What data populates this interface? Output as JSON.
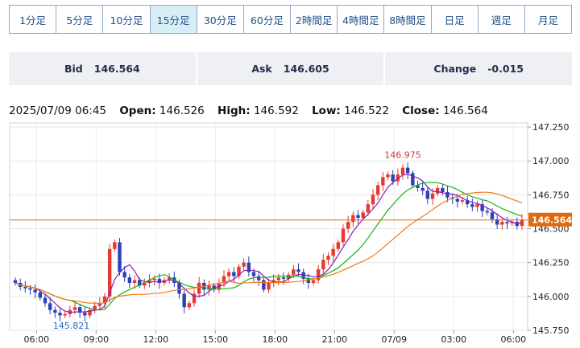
{
  "timeframes": [
    "1分足",
    "5分足",
    "10分足",
    "15分足",
    "30分足",
    "60分足",
    "2時間足",
    "4時間足",
    "8時間足",
    "日足",
    "週足",
    "月足"
  ],
  "active_timeframe": "15分足",
  "quote": {
    "bid_label": "Bid",
    "bid": "146.564",
    "ask_label": "Ask",
    "ask": "146.605",
    "change_label": "Change",
    "change": "-0.015"
  },
  "ohlc": {
    "timestamp": "2025/07/09 06:45",
    "open_label": "Open:",
    "open": "146.526",
    "high_label": "High:",
    "high": "146.592",
    "low_label": "Low:",
    "low": "146.522",
    "close_label": "Close:",
    "close": "146.564"
  },
  "chart_data": {
    "type": "candlestick",
    "y_ticks": [
      "147.250",
      "147.000",
      "146.750",
      "146.500",
      "146.250",
      "146.000",
      "145.750"
    ],
    "x_ticks": [
      "06:00",
      "09:00",
      "12:00",
      "15:00",
      "18:00",
      "21:00",
      "07/09",
      "03:00",
      "06:00"
    ],
    "ylim": [
      145.75,
      147.28
    ],
    "current_price_label": "146.564",
    "current_price": 146.564,
    "high_annotation": "146.975",
    "high_annotation_value": 146.975,
    "low_annotation": "145.821",
    "low_annotation_value": 145.821,
    "colors": {
      "up": "#e8382f",
      "down": "#2c40b8",
      "ma_short": "#8a1db8",
      "ma_mid": "#16b116",
      "ma_long": "#f07a1a",
      "price_line": "#e06a10"
    },
    "closes": [
      146.1,
      146.07,
      146.06,
      146.05,
      146.03,
      145.99,
      145.95,
      145.9,
      145.88,
      145.86,
      145.87,
      145.9,
      145.92,
      145.88,
      145.86,
      145.9,
      145.93,
      145.95,
      146.0,
      146.35,
      146.4,
      146.18,
      146.14,
      146.1,
      146.12,
      146.08,
      146.1,
      146.12,
      146.13,
      146.1,
      146.12,
      146.14,
      146.1,
      146.02,
      145.92,
      145.95,
      146.02,
      146.1,
      146.05,
      146.08,
      146.05,
      146.1,
      146.15,
      146.18,
      146.15,
      146.22,
      146.25,
      146.18,
      146.15,
      146.12,
      146.05,
      146.1,
      146.12,
      146.14,
      146.13,
      146.16,
      146.2,
      146.18,
      146.13,
      146.1,
      146.12,
      146.2,
      146.27,
      146.3,
      146.35,
      146.4,
      146.5,
      146.55,
      146.6,
      146.58,
      146.62,
      146.68,
      146.75,
      146.82,
      146.88,
      146.9,
      146.85,
      146.9,
      146.95,
      146.91,
      146.82,
      146.8,
      146.78,
      146.72,
      146.76,
      146.8,
      146.77,
      146.73,
      146.72,
      146.7,
      146.71,
      146.68,
      146.66,
      146.68,
      146.63,
      146.62,
      146.57,
      146.53,
      146.55,
      146.54,
      146.55,
      146.52,
      146.564
    ]
  }
}
